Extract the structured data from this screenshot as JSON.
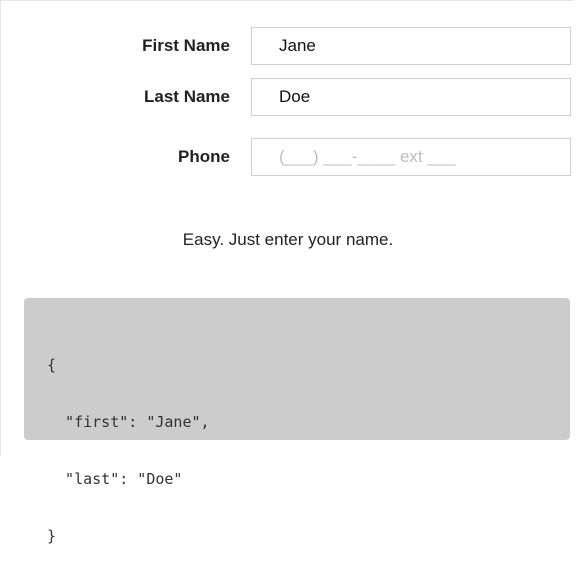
{
  "form": {
    "first_name": {
      "label": "First Name",
      "value": "Jane"
    },
    "last_name": {
      "label": "Last Name",
      "value": "Doe"
    },
    "phone": {
      "label": "Phone",
      "placeholder": "(___) ___-____ ext ___"
    }
  },
  "message": "Easy. Just enter your name.",
  "json_output": {
    "lines": [
      "{",
      "  \"first\": \"Jane\",",
      "  \"last\": \"Doe\"",
      "}"
    ]
  }
}
